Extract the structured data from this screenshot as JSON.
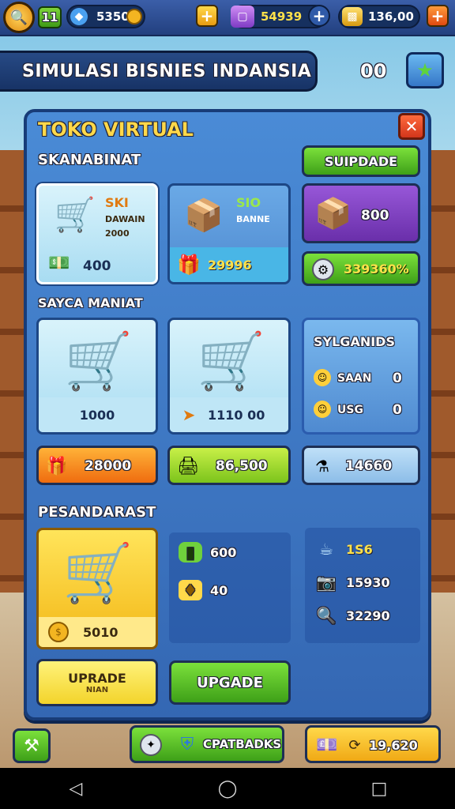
{
  "top_bar": {
    "level": "11",
    "coins": "53502",
    "gems": "54939",
    "gold": "136,00"
  },
  "title_banner": {
    "title": "SIMULASI BISNIES INDANSIA",
    "score": "00"
  },
  "panel": {
    "title": "TOKO VIRTUAL",
    "section1": {
      "title": "SKANABINAT",
      "card1": {
        "name": "SKI",
        "sub1": "DAWAIN",
        "sub2": "2000",
        "price": "400"
      },
      "card2": {
        "name": "SIO",
        "sub1": "BANNE",
        "price": "29996"
      },
      "upgrade_label": "SUIPDADE",
      "box_value": "800",
      "percent_value": "339360%"
    },
    "section2": {
      "title": "SAYCA MANIAT",
      "card1": {
        "price": "1000"
      },
      "card2": {
        "price": "1110 00"
      },
      "side_card": {
        "title": "SYLGANIDS",
        "row1_label": "SAAN",
        "row1_value": "0",
        "row2_label": "USG",
        "row2_value": "0"
      },
      "btn_orange": "28000",
      "btn_lime": "86,500",
      "btn_lightblue": "14660"
    },
    "section3": {
      "title": "PESANDARAST",
      "big_card_price": "5010",
      "stats_mid": [
        {
          "icon": "battery-icon",
          "value": "600"
        },
        {
          "icon": "ticket-icon",
          "value": "40"
        }
      ],
      "stats_right": [
        {
          "icon": "cup-icon",
          "value": "1S6"
        },
        {
          "icon": "camera-icon",
          "value": "15930"
        },
        {
          "icon": "magnifier-icon",
          "value": "32290"
        }
      ],
      "upgrade_small_label": "UPRADE",
      "upgrade_small_sub": "NIAN",
      "upgrade_big_label": "UPGADE"
    }
  },
  "bottom_bar": {
    "center_label": "CPATBADKS",
    "right_value": "19,620"
  },
  "colors": {
    "panel_blue": "#4a8bd6",
    "accent_green": "#3ea018",
    "accent_orange": "#ef6c0f",
    "accent_yellow": "#f3d42b"
  }
}
